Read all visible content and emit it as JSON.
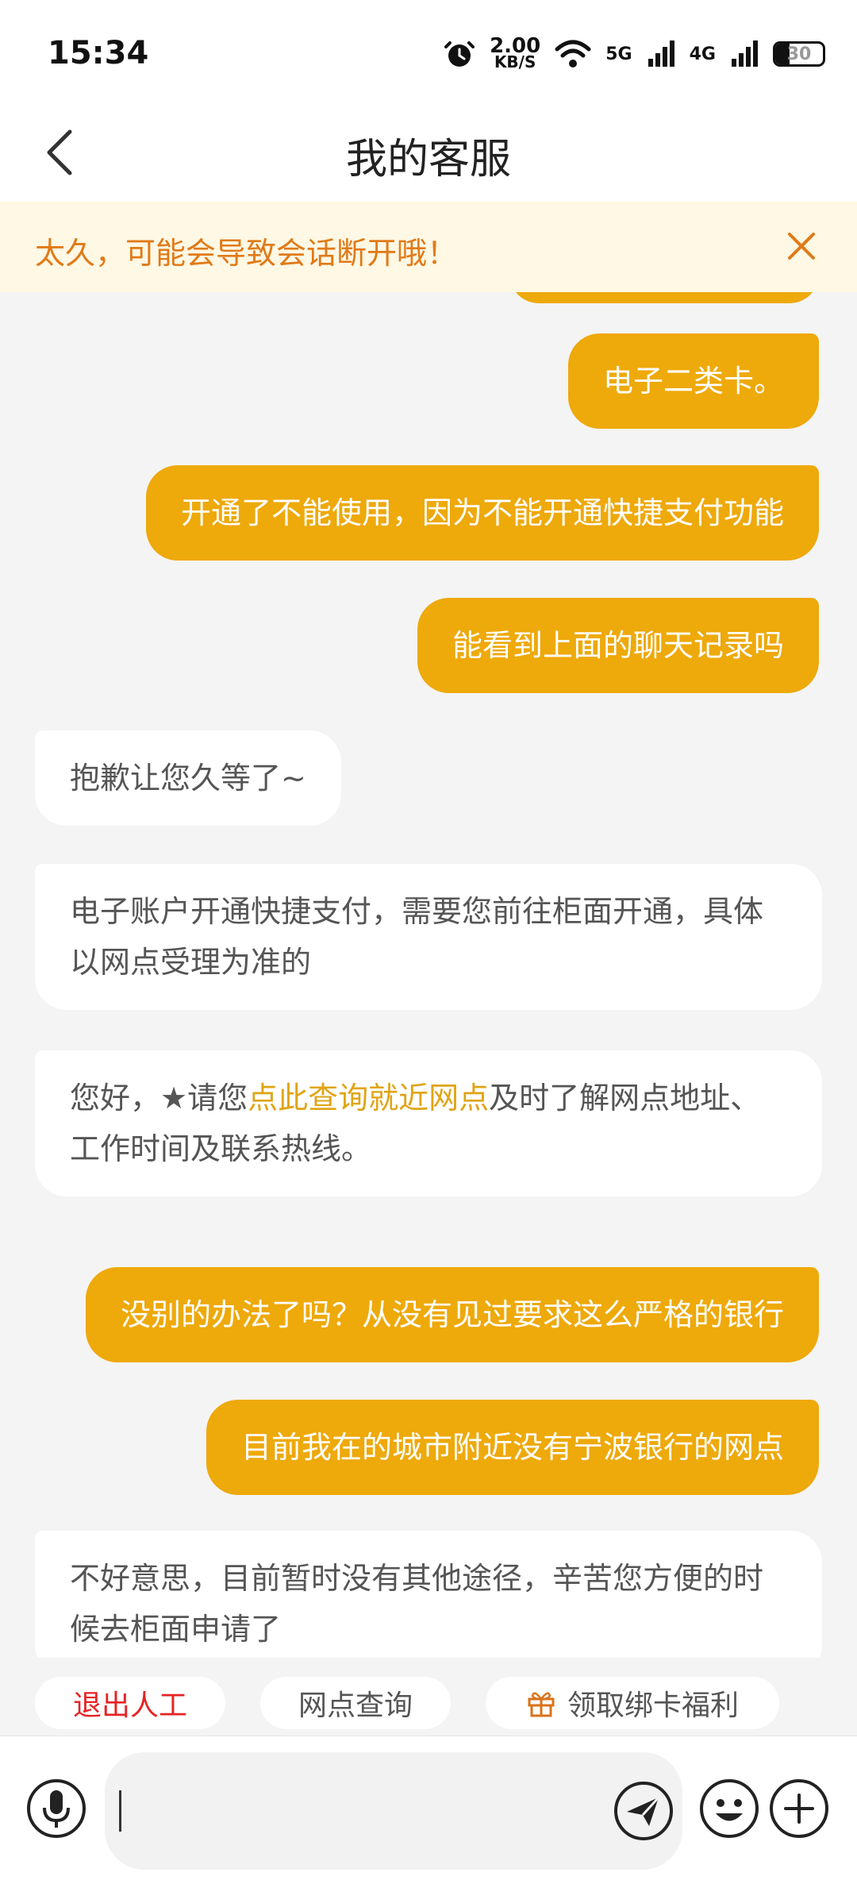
{
  "status_bar": {
    "time": "15:34",
    "speed_value": "2.00",
    "speed_unit": "KB/S",
    "net1": "5G",
    "net2": "4G",
    "battery": "30",
    "icons": [
      "alarm-icon",
      "wifi-icon",
      "signal-icon",
      "battery-icon"
    ]
  },
  "header": {
    "title": "我的客服",
    "back_icon": "chevron-left-icon"
  },
  "notice": {
    "text": "太久，可能会导致会话断开哦！",
    "close_icon": "close-icon"
  },
  "messages": [
    {
      "from": "user",
      "text": "电子二类卡。"
    },
    {
      "from": "user",
      "text": "开通了不能使用，因为不能开通快捷支付功能"
    },
    {
      "from": "user",
      "text": "能看到上面的聊天记录吗"
    },
    {
      "from": "agent",
      "text": "抱歉让您久等了~"
    },
    {
      "from": "agent",
      "text": "电子账户开通快捷支付，需要您前往柜面开通，具体以网点受理为准的"
    },
    {
      "from": "agent",
      "pre": "您好，★请您",
      "link": "点此查询就近网点",
      "post": "及时了解网点地址、工作时间及联系热线。"
    },
    {
      "from": "user",
      "text": "没别的办法了吗？从没有见过要求这么严格的银行"
    },
    {
      "from": "user",
      "text": "目前我在的城市附近没有宁波银行的网点"
    },
    {
      "from": "agent",
      "text": "不好意思，目前暂时没有其他途径，辛苦您方便的时候去柜面申请了"
    }
  ],
  "quick_actions": [
    {
      "label": "退出人工"
    },
    {
      "label": "网点查询"
    },
    {
      "label": "领取绑卡福利",
      "icon": "gift-icon"
    }
  ],
  "input": {
    "value": "",
    "icons": [
      "microphone-icon",
      "send-icon",
      "emoji-icon",
      "plus-icon"
    ]
  },
  "colors": {
    "accent": "#eea90a",
    "notice_text": "#e07a18",
    "danger": "#e62323",
    "link": "#e0a414",
    "background": "#f4f4f4"
  }
}
